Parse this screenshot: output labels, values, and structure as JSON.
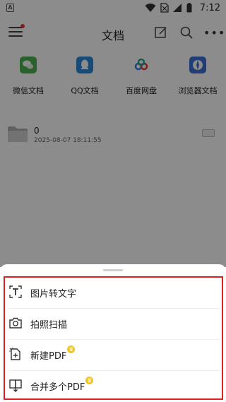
{
  "status_bar": {
    "app_indicator": "A",
    "time": "7:12",
    "icons": [
      "wifi-icon",
      "no-sim-icon",
      "signal-icon",
      "battery-icon"
    ]
  },
  "app_bar": {
    "title": "文档",
    "icons": [
      "menu-icon",
      "edit-icon",
      "search-icon",
      "more-icon"
    ]
  },
  "sources": [
    {
      "label": "微信文档",
      "icon": "wechat-icon",
      "color": "#4caf50"
    },
    {
      "label": "QQ文档",
      "icon": "qq-icon",
      "color": "#2b8bdc"
    },
    {
      "label": "百度网盘",
      "icon": "baidu-netdisk-icon",
      "color": "#2f80ed"
    },
    {
      "label": "浏览器文档",
      "icon": "browser-icon",
      "color": "#3b6fd8"
    }
  ],
  "files": [
    {
      "name": "0",
      "date": "2025-08-07 18:11:55",
      "icon": "folder-icon"
    }
  ],
  "sheet": {
    "items": [
      {
        "label": "图片转文字",
        "icon": "image-to-text-icon",
        "vip": false
      },
      {
        "label": "拍照扫描",
        "icon": "camera-icon",
        "vip": false
      },
      {
        "label": "新建PDF",
        "icon": "new-pdf-icon",
        "vip": true
      },
      {
        "label": "合并多个PDF",
        "icon": "merge-pdf-icon",
        "vip": true
      }
    ]
  },
  "colors": {
    "highlight_border": "#e02020",
    "vip_badge": "#f5c518",
    "overlay": "rgba(0,0,0,0.45)"
  }
}
